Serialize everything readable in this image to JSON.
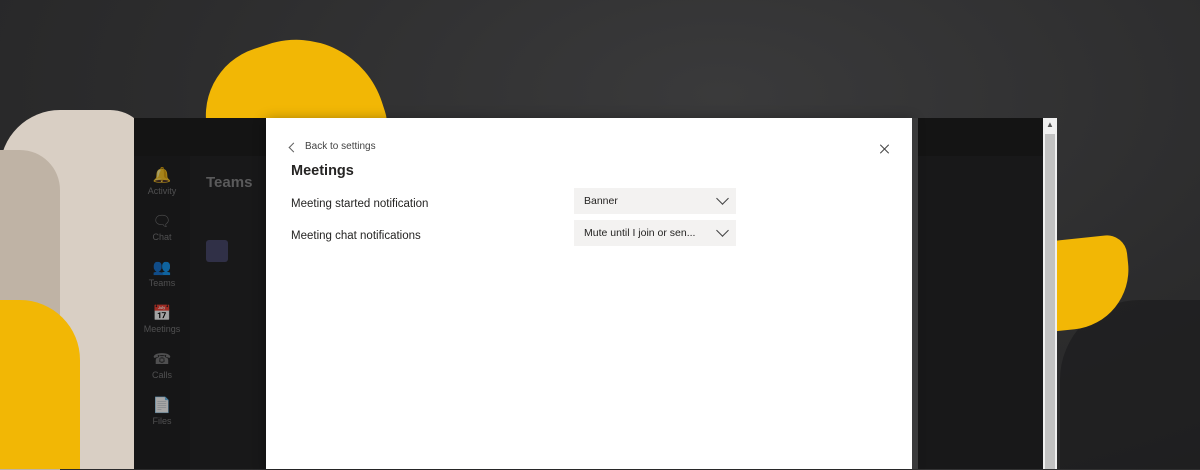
{
  "teams_window": {
    "heading": "Teams",
    "rail": [
      {
        "label": "Activity",
        "icon": "bell-icon"
      },
      {
        "label": "Chat",
        "icon": "chat-icon"
      },
      {
        "label": "Teams",
        "icon": "teams-icon"
      },
      {
        "label": "Meetings",
        "icon": "calendar-icon"
      },
      {
        "label": "Calls",
        "icon": "phone-icon"
      },
      {
        "label": "Files",
        "icon": "file-icon"
      }
    ]
  },
  "dialog": {
    "back_label": "Back to settings",
    "title": "Meetings",
    "settings": [
      {
        "label": "Meeting started notification",
        "value": "Banner"
      },
      {
        "label": "Meeting chat notifications",
        "value": "Mute until I join or sen..."
      }
    ]
  }
}
